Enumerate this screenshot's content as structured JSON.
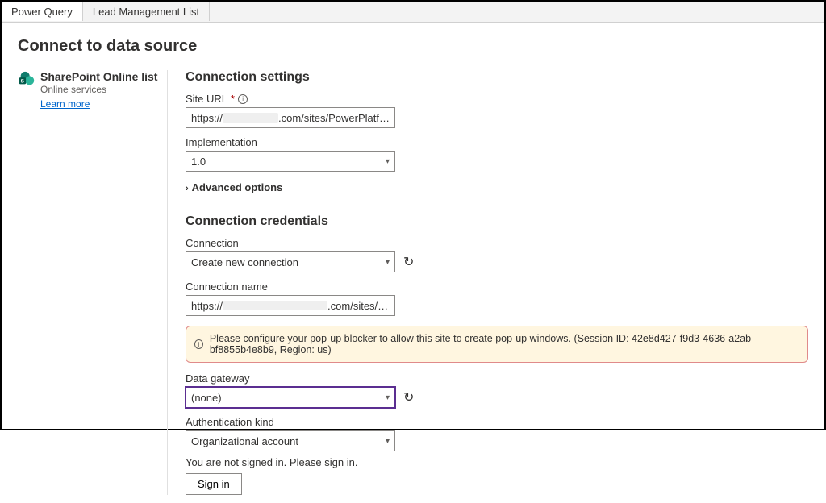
{
  "tabs": {
    "t0": "Power Query",
    "t1": "Lead Management List"
  },
  "page_title": "Connect to data source",
  "datasource": {
    "name": "SharePoint Online list",
    "category": "Online services",
    "learn_more": "Learn more"
  },
  "settings": {
    "heading": "Connection settings",
    "site_url_label": "Site URL",
    "site_url_prefix": "https://",
    "site_url_suffix": ".com/sites/PowerPlatf…",
    "impl_label": "Implementation",
    "impl_value": "1.0",
    "advanced": "Advanced options"
  },
  "credentials": {
    "heading": "Connection credentials",
    "connection_label": "Connection",
    "connection_value": "Create new connection",
    "conn_name_label": "Connection name",
    "conn_name_prefix": "https://",
    "conn_name_suffix": ".com/sites/…",
    "alert": "Please configure your pop-up blocker to allow this site to create pop-up windows. (Session ID: 42e8d427-f9d3-4636-a2ab-bf8855b4e8b9, Region: us)",
    "gateway_label": "Data gateway",
    "gateway_value": "(none)",
    "auth_label": "Authentication kind",
    "auth_value": "Organizational account",
    "signin_msg": "You are not signed in. Please sign in.",
    "signin_btn": "Sign in"
  }
}
